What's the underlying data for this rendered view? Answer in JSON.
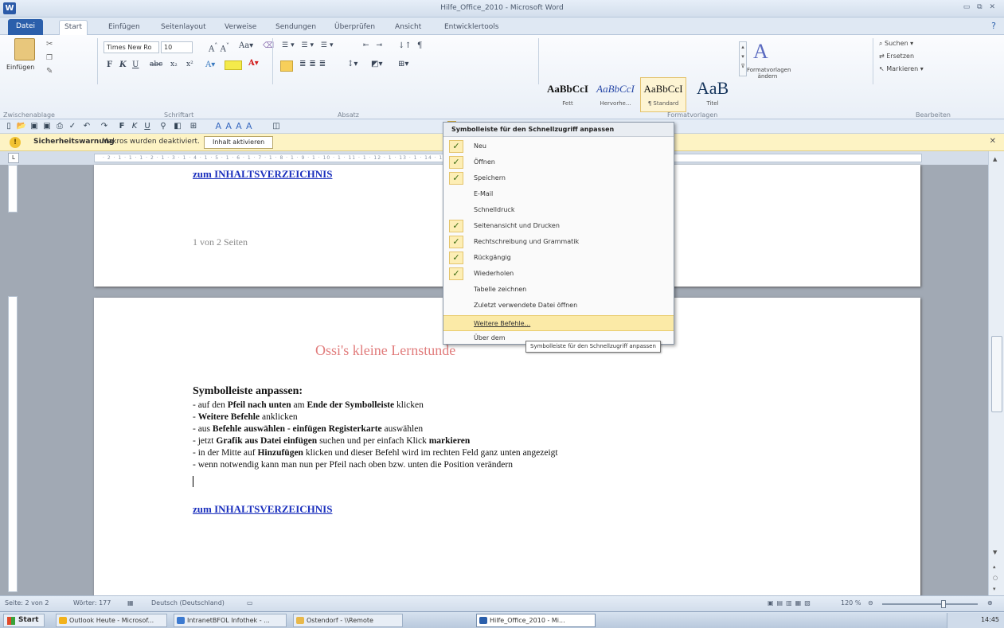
{
  "app": {
    "title": "Hilfe_Office_2010 - Microsoft Word",
    "icon_letter": "W",
    "window_buttons": "▭ ⧉ ✕"
  },
  "tabs": [
    "Datei",
    "Start",
    "Einfügen",
    "Seitenlayout",
    "Verweise",
    "Sendungen",
    "Überprüfen",
    "Ansicht",
    "Entwicklertools"
  ],
  "ribbon": {
    "paste_label": "Einfügen",
    "font_name": "Times New Ro",
    "font_size": "10",
    "groups": [
      "Zwischenablage",
      "Schriftart",
      "Absatz",
      "Formatvorlagen",
      "Bearbeiten"
    ],
    "styles": [
      {
        "sample": "AaBbCcI",
        "name": "Fett"
      },
      {
        "sample": "AaBbCcI",
        "name": "Hervorhe..."
      },
      {
        "sample": "AaBbCcI",
        "name": "¶ Standard"
      },
      {
        "sample": "AaB",
        "name": "Titel"
      }
    ],
    "change_styles": "Formatvorlagen ändern",
    "edit": {
      "find": "Suchen",
      "replace": "Ersetzen",
      "select": "Markieren"
    }
  },
  "security_bar": {
    "label": "Sicherheitswarnung",
    "message": "Makros wurden deaktiviert.",
    "button": "Inhalt aktivieren"
  },
  "menu": {
    "header": "Symbolleiste für den Schnellzugriff anpassen",
    "items": [
      {
        "label": "Neu",
        "checked": true
      },
      {
        "label": "Öffnen",
        "checked": true
      },
      {
        "label": "Speichern",
        "checked": true
      },
      {
        "label": "E-Mail",
        "checked": false
      },
      {
        "label": "Schnelldruck",
        "checked": false
      },
      {
        "label": "Seitenansicht und Drucken",
        "checked": true
      },
      {
        "label": "Rechtschreibung und Grammatik",
        "checked": true
      },
      {
        "label": "Rückgängig",
        "checked": true
      },
      {
        "label": "Wiederholen",
        "checked": true
      },
      {
        "label": "Tabelle zeichnen",
        "checked": false
      },
      {
        "label": "Zuletzt verwendete Datei öffnen",
        "checked": false
      },
      {
        "label": "Weitere Befehle...",
        "checked": false
      },
      {
        "label": "Über dem",
        "checked": false
      }
    ],
    "tooltip": "Symbolleiste für den Schnellzugriff anpassen"
  },
  "document": {
    "link_top": "zum  INHALTSVERZEICHNIS",
    "page_number": "1 von  2 Seiten",
    "heading": "Ossi's kleine Lernstunde",
    "subhead": "Symbolleiste  anpassen:",
    "lines": [
      {
        "pre": "- auf  den  ",
        "b1": "Pfeil  nach  unten",
        "mid": "  am  ",
        "b2": "Ende  der  Symbolleiste",
        "post": "  klicken"
      },
      {
        "pre": "- ",
        "b1": "Weitere  Befehle",
        "mid": "  anklicken",
        "b2": "",
        "post": ""
      },
      {
        "pre": "- aus  ",
        "b1": "Befehle  auswählen  -  einfügen  Registerkarte",
        "mid": "  auswählen",
        "b2": "",
        "post": ""
      },
      {
        "pre": "- jetzt  ",
        "b1": "Grafik  aus  Datei einfügen",
        "mid": "  suchen  und  per einfach  Klick  ",
        "b2": "markieren",
        "post": ""
      },
      {
        "pre": "- in  der Mitte  auf  ",
        "b1": "Hinzufügen",
        "mid": "  klicken  und  dieser  Befehl  wird  im  rechten  Feld ganz  unten  angezeigt",
        "b2": "",
        "post": ""
      },
      {
        "pre": "- wenn  notwendig  kann  man  nun  per Pfeil  nach  oben  bzw.  unten  die Position  verändern",
        "b1": "",
        "mid": "",
        "b2": "",
        "post": ""
      }
    ],
    "link_bottom": "zum  INHALTSVERZEICHNIS"
  },
  "status": {
    "page": "Seite: 2 von 2",
    "words": "Wörter: 177",
    "language": "Deutsch (Deutschland)",
    "zoom": "120 %"
  },
  "taskbar": {
    "start": "Start",
    "items": [
      "Outlook Heute - Microsof...",
      "IntranetBFOL Infothek - ...",
      "Ostendorf - \\\\Remote",
      "Hilfe_Office_2010 - Mi..."
    ],
    "clock": "14:45"
  },
  "colors": {
    "accent": "#2b5fab",
    "security_bg": "#fdf3c4",
    "heading": "#e17c7c",
    "link": "#1a2fbd",
    "highlight": "#fbeaa7"
  }
}
